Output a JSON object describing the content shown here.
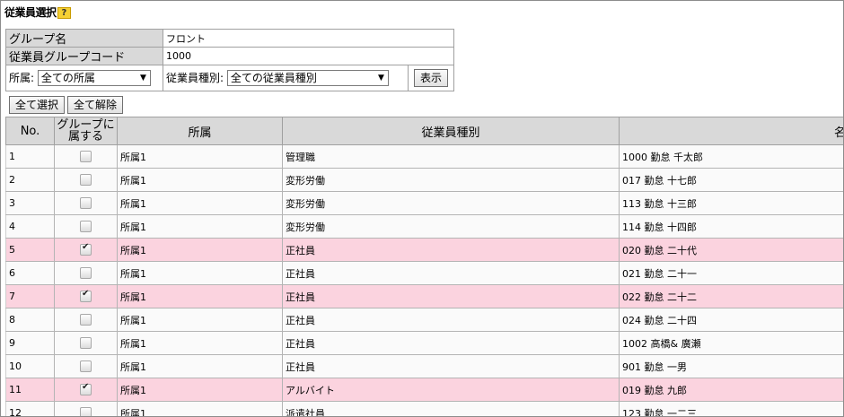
{
  "page": {
    "title": "従業員選択",
    "help": "?"
  },
  "info": {
    "group_name_label": "グループ名",
    "group_name_value": "フロント",
    "group_code_label": "従業員グループコード",
    "group_code_value": "1000"
  },
  "filter": {
    "affiliation_label": "所属:",
    "affiliation_value": "全ての所属",
    "emp_type_label": "従業員種別:",
    "emp_type_value": "全ての従業員種別",
    "show_button": "表示"
  },
  "actions": {
    "select_all": "全て選択",
    "clear_all": "全て解除"
  },
  "table": {
    "headers": {
      "no": "No.",
      "member": "グループに\n属する",
      "affiliation": "所属",
      "emp_type": "従業員種別",
      "name": "名"
    },
    "rows": [
      {
        "no": "1",
        "checked": false,
        "affiliation": "所属1",
        "emp_type": "管理職",
        "name": "1000 勤怠 千太郎"
      },
      {
        "no": "2",
        "checked": false,
        "affiliation": "所属1",
        "emp_type": "変形労働",
        "name": "017 勤怠 十七郎"
      },
      {
        "no": "3",
        "checked": false,
        "affiliation": "所属1",
        "emp_type": "変形労働",
        "name": "113 勤怠 十三郎"
      },
      {
        "no": "4",
        "checked": false,
        "affiliation": "所属1",
        "emp_type": "変形労働",
        "name": "114 勤怠 十四郎"
      },
      {
        "no": "5",
        "checked": true,
        "affiliation": "所属1",
        "emp_type": "正社員",
        "name": "020 勤怠 二十代"
      },
      {
        "no": "6",
        "checked": false,
        "affiliation": "所属1",
        "emp_type": "正社員",
        "name": "021 勤怠 二十一"
      },
      {
        "no": "7",
        "checked": true,
        "affiliation": "所属1",
        "emp_type": "正社員",
        "name": "022 勤怠 二十二"
      },
      {
        "no": "8",
        "checked": false,
        "affiliation": "所属1",
        "emp_type": "正社員",
        "name": "024 勤怠 二十四"
      },
      {
        "no": "9",
        "checked": false,
        "affiliation": "所属1",
        "emp_type": "正社員",
        "name": "1002 高橋& 廣瀬"
      },
      {
        "no": "10",
        "checked": false,
        "affiliation": "所属1",
        "emp_type": "正社員",
        "name": "901 勤怠 一男"
      },
      {
        "no": "11",
        "checked": true,
        "affiliation": "所属1",
        "emp_type": "アルバイト",
        "name": "019 勤怠 九郎"
      },
      {
        "no": "12",
        "checked": false,
        "affiliation": "所属1",
        "emp_type": "派遣社員",
        "name": "123 勤怠 一二三"
      }
    ]
  }
}
